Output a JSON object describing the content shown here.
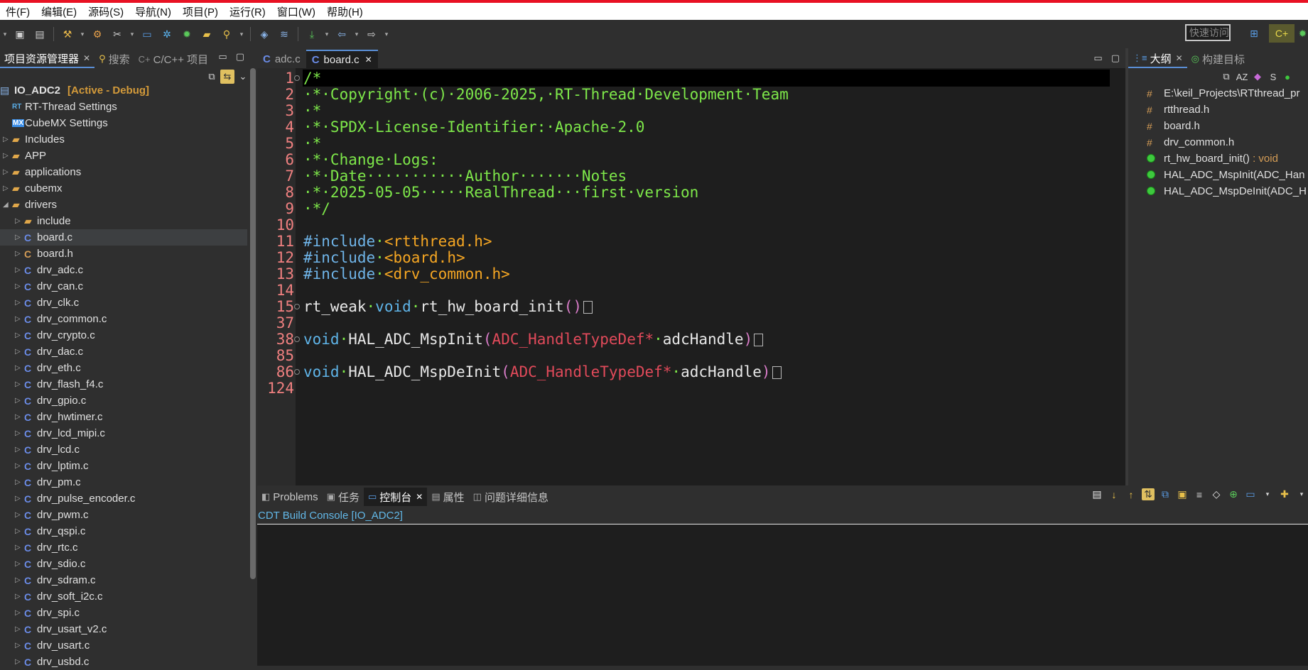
{
  "menu": [
    "件(F)",
    "编辑(E)",
    "源码(S)",
    "导航(N)",
    "项目(P)",
    "运行(R)",
    "窗口(W)",
    "帮助(H)"
  ],
  "toolbar": {
    "quick_access": "快速访问",
    "icons": [
      "save-icon",
      "save-all-icon",
      "build-icon",
      "hammer-icon",
      "tools-icon",
      "debug-display-icon",
      "gear-icon",
      "bug-icon",
      "open-folder-icon",
      "search-icon",
      "layers-icon",
      "stack-icon",
      "download-icon",
      "back-icon",
      "forward-icon"
    ]
  },
  "left_panel": {
    "tabs": [
      {
        "label": "项目资源管理器",
        "icon": "project-explorer-icon",
        "active": true,
        "closable": true
      },
      {
        "label": "搜索",
        "icon": "search-icon",
        "active": false
      },
      {
        "label": "C/C++ 项目",
        "icon": "cpp-project-icon",
        "active": false
      }
    ],
    "project": {
      "name": "IO_ADC2",
      "status": "[Active - Debug]"
    },
    "tree": [
      {
        "label": "RT-Thread Settings",
        "icon": "RT",
        "level": 1,
        "kind": "settings"
      },
      {
        "label": "CubeMX Settings",
        "icon": "MX",
        "level": 1,
        "kind": "settings"
      },
      {
        "label": "Includes",
        "level": 1,
        "kind": "folder",
        "arrow": "▷"
      },
      {
        "label": "APP",
        "level": 1,
        "kind": "folder",
        "arrow": "▷"
      },
      {
        "label": "applications",
        "level": 1,
        "kind": "folder",
        "arrow": "▷"
      },
      {
        "label": "cubemx",
        "level": 1,
        "kind": "folder",
        "arrow": "▷"
      },
      {
        "label": "drivers",
        "level": 1,
        "kind": "folder",
        "arrow": "◢"
      },
      {
        "label": "include",
        "level": 2,
        "kind": "folder",
        "arrow": "▷"
      },
      {
        "label": "board.c",
        "level": 2,
        "kind": "c",
        "arrow": "▷",
        "selected": true
      },
      {
        "label": "board.h",
        "level": 2,
        "kind": "h",
        "arrow": "▷"
      },
      {
        "label": "drv_adc.c",
        "level": 2,
        "kind": "c",
        "arrow": "▷"
      },
      {
        "label": "drv_can.c",
        "level": 2,
        "kind": "c",
        "arrow": "▷"
      },
      {
        "label": "drv_clk.c",
        "level": 2,
        "kind": "c",
        "arrow": "▷"
      },
      {
        "label": "drv_common.c",
        "level": 2,
        "kind": "c",
        "arrow": "▷"
      },
      {
        "label": "drv_crypto.c",
        "level": 2,
        "kind": "c",
        "arrow": "▷"
      },
      {
        "label": "drv_dac.c",
        "level": 2,
        "kind": "c",
        "arrow": "▷"
      },
      {
        "label": "drv_eth.c",
        "level": 2,
        "kind": "c",
        "arrow": "▷"
      },
      {
        "label": "drv_flash_f4.c",
        "level": 2,
        "kind": "c",
        "arrow": "▷"
      },
      {
        "label": "drv_gpio.c",
        "level": 2,
        "kind": "c",
        "arrow": "▷"
      },
      {
        "label": "drv_hwtimer.c",
        "level": 2,
        "kind": "c",
        "arrow": "▷"
      },
      {
        "label": "drv_lcd_mipi.c",
        "level": 2,
        "kind": "c",
        "arrow": "▷"
      },
      {
        "label": "drv_lcd.c",
        "level": 2,
        "kind": "c",
        "arrow": "▷"
      },
      {
        "label": "drv_lptim.c",
        "level": 2,
        "kind": "c",
        "arrow": "▷"
      },
      {
        "label": "drv_pm.c",
        "level": 2,
        "kind": "c",
        "arrow": "▷"
      },
      {
        "label": "drv_pulse_encoder.c",
        "level": 2,
        "kind": "c",
        "arrow": "▷"
      },
      {
        "label": "drv_pwm.c",
        "level": 2,
        "kind": "c",
        "arrow": "▷"
      },
      {
        "label": "drv_qspi.c",
        "level": 2,
        "kind": "c",
        "arrow": "▷"
      },
      {
        "label": "drv_rtc.c",
        "level": 2,
        "kind": "c",
        "arrow": "▷"
      },
      {
        "label": "drv_sdio.c",
        "level": 2,
        "kind": "c",
        "arrow": "▷"
      },
      {
        "label": "drv_sdram.c",
        "level": 2,
        "kind": "c",
        "arrow": "▷"
      },
      {
        "label": "drv_soft_i2c.c",
        "level": 2,
        "kind": "c",
        "arrow": "▷"
      },
      {
        "label": "drv_spi.c",
        "level": 2,
        "kind": "c",
        "arrow": "▷"
      },
      {
        "label": "drv_usart_v2.c",
        "level": 2,
        "kind": "c",
        "arrow": "▷"
      },
      {
        "label": "drv_usart.c",
        "level": 2,
        "kind": "c",
        "arrow": "▷"
      },
      {
        "label": "drv_usbd.c",
        "level": 2,
        "kind": "c",
        "arrow": "▷"
      }
    ]
  },
  "editor": {
    "tabs": [
      {
        "label": "adc.c",
        "active": false
      },
      {
        "label": "board.c",
        "active": true,
        "closable": true
      }
    ],
    "lines": [
      {
        "num": "1",
        "fold": true,
        "parts": [
          {
            "t": "/*",
            "c": "cm"
          }
        ]
      },
      {
        "num": "2",
        "parts": [
          {
            "t": "·*·Copyright·(c)·2006-2025,·RT-Thread·Development·Team",
            "c": "cm"
          }
        ]
      },
      {
        "num": "3",
        "parts": [
          {
            "t": "·*",
            "c": "cm"
          }
        ]
      },
      {
        "num": "4",
        "parts": [
          {
            "t": "·*·SPDX-License-Identifier:·Apache-2.0",
            "c": "cm"
          }
        ]
      },
      {
        "num": "5",
        "parts": [
          {
            "t": "·*",
            "c": "cm"
          }
        ]
      },
      {
        "num": "6",
        "parts": [
          {
            "t": "·*·Change·Logs:",
            "c": "cm"
          }
        ]
      },
      {
        "num": "7",
        "parts": [
          {
            "t": "·*·Date···········Author·······Notes",
            "c": "cm"
          }
        ]
      },
      {
        "num": "8",
        "parts": [
          {
            "t": "·*·2025-05-05·····RealThread···first·version",
            "c": "cm"
          }
        ]
      },
      {
        "num": "9",
        "parts": [
          {
            "t": "·*/",
            "c": "cm"
          }
        ]
      },
      {
        "num": "10",
        "parts": []
      },
      {
        "num": "11",
        "parts": [
          {
            "t": "#include",
            "c": "pp"
          },
          {
            "t": "·",
            "c": "cm"
          },
          {
            "t": "<rtthread.h>",
            "c": "inc"
          }
        ]
      },
      {
        "num": "12",
        "parts": [
          {
            "t": "#include",
            "c": "pp"
          },
          {
            "t": "·",
            "c": "cm"
          },
          {
            "t": "<board.h>",
            "c": "inc"
          }
        ]
      },
      {
        "num": "13",
        "parts": [
          {
            "t": "#include",
            "c": "pp"
          },
          {
            "t": "·",
            "c": "cm"
          },
          {
            "t": "<drv_common.h>",
            "c": "inc"
          }
        ]
      },
      {
        "num": "14",
        "parts": []
      },
      {
        "num": "15",
        "fold": true,
        "box": true,
        "parts": [
          {
            "t": "rt_weak",
            "c": ""
          },
          {
            "t": "·",
            "c": "cm"
          },
          {
            "t": "void",
            "c": "kw"
          },
          {
            "t": "·",
            "c": "cm"
          },
          {
            "t": "rt_hw_board_init",
            "c": ""
          },
          {
            "t": "()",
            "c": "paren"
          }
        ]
      },
      {
        "num": "37",
        "parts": []
      },
      {
        "num": "38",
        "fold": true,
        "box": true,
        "parts": [
          {
            "t": "void",
            "c": "kw"
          },
          {
            "t": "·",
            "c": "cm"
          },
          {
            "t": "HAL_ADC_MspInit",
            "c": ""
          },
          {
            "t": "(",
            "c": "paren"
          },
          {
            "t": "ADC_HandleTypeDef*",
            "c": "ty"
          },
          {
            "t": "·",
            "c": "cm"
          },
          {
            "t": "adcHandle",
            "c": ""
          },
          {
            "t": ")",
            "c": "paren"
          }
        ]
      },
      {
        "num": "85",
        "parts": []
      },
      {
        "num": "86",
        "fold": true,
        "box": true,
        "parts": [
          {
            "t": "void",
            "c": "kw"
          },
          {
            "t": "·",
            "c": "cm"
          },
          {
            "t": "HAL_ADC_MspDeInit",
            "c": ""
          },
          {
            "t": "(",
            "c": "paren"
          },
          {
            "t": "ADC_HandleTypeDef*",
            "c": "ty"
          },
          {
            "t": "·",
            "c": "cm"
          },
          {
            "t": "adcHandle",
            "c": ""
          },
          {
            "t": ")",
            "c": "paren"
          }
        ]
      },
      {
        "num": "124",
        "parts": []
      }
    ]
  },
  "outline": {
    "tabs": [
      {
        "label": "大纲",
        "active": true,
        "closable": true
      },
      {
        "label": "构建目标",
        "active": false
      }
    ],
    "items": [
      {
        "label": "E:\\keil_Projects\\RTthread_pr",
        "kind": "include"
      },
      {
        "label": "rtthread.h",
        "kind": "include"
      },
      {
        "label": "board.h",
        "kind": "include"
      },
      {
        "label": "drv_common.h",
        "kind": "include"
      },
      {
        "label": "rt_hw_board_init()",
        "suffix": " : void",
        "kind": "function"
      },
      {
        "label": "HAL_ADC_MspInit(ADC_Han",
        "kind": "function"
      },
      {
        "label": "HAL_ADC_MspDeInit(ADC_H",
        "kind": "function"
      }
    ]
  },
  "console": {
    "tabs": [
      {
        "label": "Problems",
        "icon": "problems-icon",
        "active": false
      },
      {
        "label": "任务",
        "icon": "tasks-icon",
        "active": false
      },
      {
        "label": "控制台",
        "icon": "console-icon",
        "active": true,
        "closable": true
      },
      {
        "label": "属性",
        "icon": "properties-icon",
        "active": false
      },
      {
        "label": "问题详细信息",
        "icon": "problem-details-icon",
        "active": false
      }
    ],
    "title": "CDT Build Console [IO_ADC2]"
  },
  "colors": {
    "background": "#2f2f2f",
    "editor_bg": "#1e1e1e",
    "comment": "#7ee84a",
    "keyword": "#5fb4e8",
    "include_path": "#f5a623",
    "type": "#e14a5a",
    "line_number": "#f08080",
    "active_tag": "#d39a3a"
  }
}
